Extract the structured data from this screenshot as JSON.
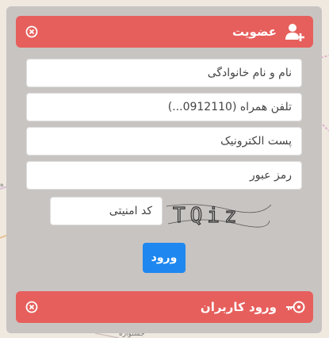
{
  "signup": {
    "title": "عضویت",
    "fields": {
      "fullname": "نام و نام خانوادگی",
      "phone": "تلفن همراه (0912110...)",
      "email": "پست الکترونیک",
      "password": "رمز عبور"
    },
    "captcha": {
      "placeholder": "کد امنیتی",
      "image_text": "TQiz"
    },
    "submit_label": "ورود"
  },
  "login": {
    "title": "ورود کاربران"
  },
  "map": {
    "labels": [
      "ه",
      "جشنواره"
    ]
  },
  "colors": {
    "header": "#e65f5c",
    "panel": "#c8c4c2",
    "button": "#1e88f0"
  }
}
